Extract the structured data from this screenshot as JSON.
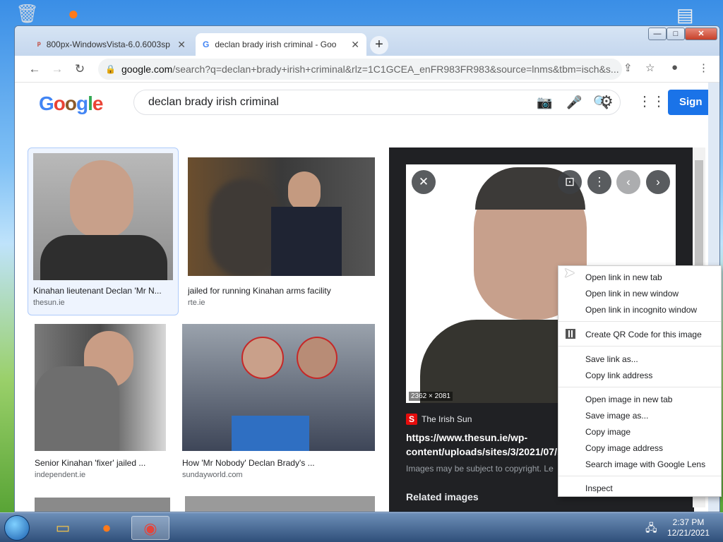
{
  "desktop": {
    "icons": [
      "recycle-bin-icon",
      "firefox-desktop-icon",
      "document-icon"
    ]
  },
  "tabs": [
    {
      "title": "800px-WindowsVista-6.0.6003sp",
      "icon": "pdf-icon"
    },
    {
      "title": "declan brady irish criminal - Goo",
      "icon": "google-icon"
    }
  ],
  "window_controls": {
    "min": "—",
    "max": "□",
    "close": "✕"
  },
  "address": {
    "host": "google.com",
    "path": "/search?q=declan+brady+irish+criminal&rlz=1C1GCEA_enFR983FR983&source=lnms&tbm=isch&s..."
  },
  "google": {
    "logo": [
      "G",
      "o",
      "o",
      "g",
      "l",
      "e"
    ],
    "query": "declan brady irish criminal",
    "signin": "Sign in"
  },
  "results": [
    {
      "caption": "Kinahan lieutenant Declan 'Mr N...",
      "source": "thesun.ie"
    },
    {
      "caption": "jailed for running Kinahan arms facility",
      "source": "rte.ie"
    },
    {
      "caption": "Senior Kinahan 'fixer' jailed ...",
      "source": "independent.ie"
    },
    {
      "caption": "How 'Mr Nobody' Declan Brady's ...",
      "source": "sundayworld.com"
    }
  ],
  "viewer": {
    "dimensions": "2362 × 2081",
    "source_logo": "S",
    "source_name": "The Irish Sun",
    "url": "https://www.thesun.ie/wp-content/uploads/sites/3/2021/07/...",
    "copyright": "Images may be subject to copyright. Le",
    "related": "Related images"
  },
  "context_menu": [
    "Open link in new tab",
    "Open link in new window",
    "Open link in incognito window",
    "Create QR Code for this image",
    "Save link as...",
    "Copy link address",
    "Open image in new tab",
    "Save image as...",
    "Copy image",
    "Copy image address",
    "Search image with Google Lens",
    "Inspect"
  ],
  "taskbar": {
    "time": "2:37 PM",
    "date": "12/21/2021"
  },
  "colors": {
    "accent": "#1a73e8",
    "viewer_bg": "#202124",
    "sun_red": "#e50c0c"
  }
}
